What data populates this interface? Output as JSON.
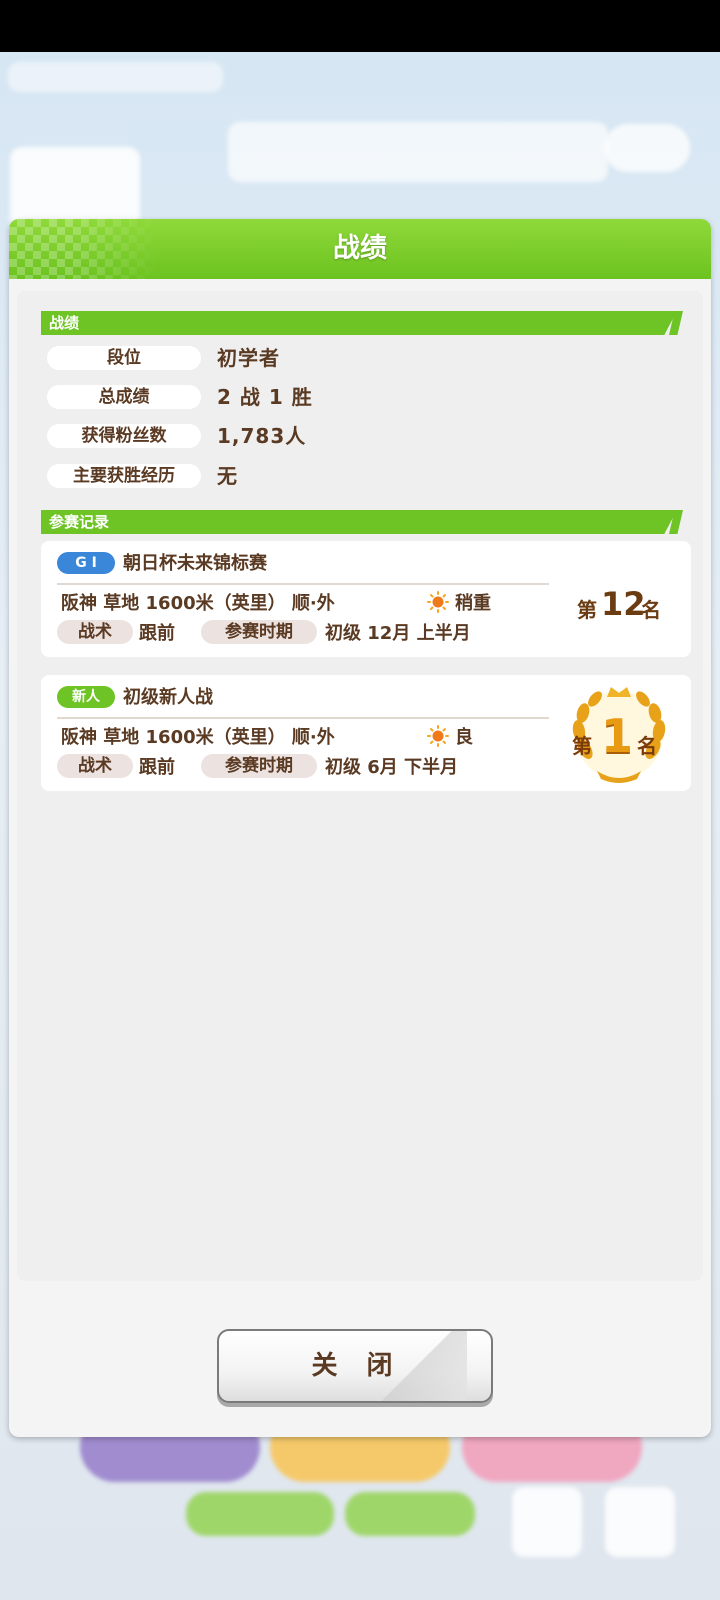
{
  "modal": {
    "title": "战绩",
    "close_label": "关 闭"
  },
  "record_section": {
    "label": "战绩",
    "stats": [
      {
        "label": "段位",
        "value": "初学者"
      },
      {
        "label": "总成绩",
        "value": "2 战 1 胜"
      },
      {
        "label": "获得粉丝数",
        "value": "1,783人"
      },
      {
        "label": "主要获胜经历",
        "value": "无"
      }
    ]
  },
  "races_section": {
    "label": "参赛记录",
    "races": [
      {
        "grade": "G I",
        "grade_color": "#3a86d9",
        "name": "朝日杯未来锦标赛",
        "course": "阪神  草地  1600米（英里） 顺·外",
        "weather_icon": "sun-icon",
        "track_condition": "稍重",
        "tactic_label": "战术",
        "tactic_value": "跟前",
        "period_label": "参赛时期",
        "period_value": "初级  12月  上半月",
        "rank_prefix": "第",
        "rank_number": "12",
        "rank_suffix": "名"
      },
      {
        "grade": "新人",
        "grade_color": "#6dc424",
        "name": "初级新人战",
        "course": "阪神  草地  1600米（英里） 顺·外",
        "weather_icon": "sun-icon",
        "track_condition": "良",
        "tactic_label": "战术",
        "tactic_value": "跟前",
        "period_label": "参赛时期",
        "period_value": "初级  6月  下半月",
        "rank_prefix": "第",
        "rank_number": "1",
        "rank_suffix": "名"
      }
    ]
  },
  "colors": {
    "header_green": "#6cc320",
    "text_brown": "#5a3a22",
    "gold": "#e8a21a"
  }
}
